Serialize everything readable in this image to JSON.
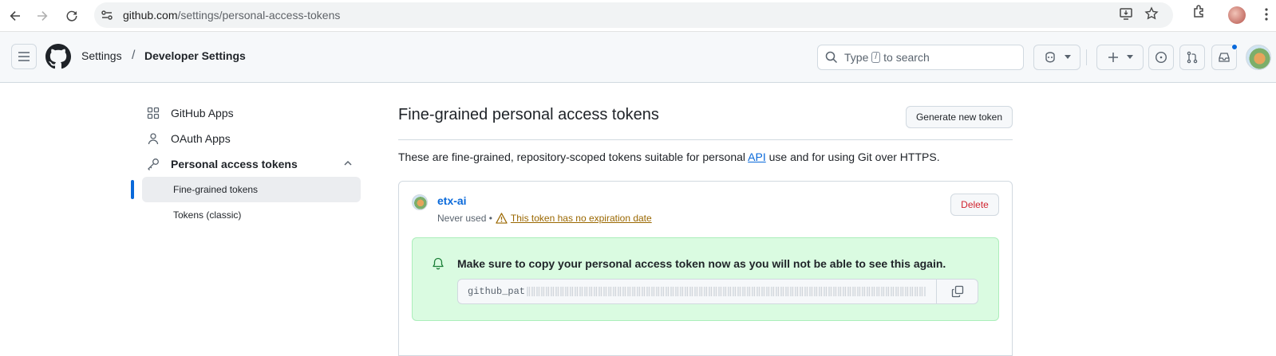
{
  "browser": {
    "url_domain": "github.com",
    "url_path": "/settings/personal-access-tokens",
    "icons": [
      "back-icon",
      "forward-icon",
      "reload-icon",
      "site-info-icon",
      "install-app-icon",
      "bookmark-star-icon",
      "extensions-icon",
      "profile-avatar",
      "more-vert-icon"
    ]
  },
  "header": {
    "breadcrumb_parent": "Settings",
    "breadcrumb_separator": "/",
    "breadcrumb_current": "Developer Settings",
    "search_prefix": "Type",
    "search_key": "/",
    "search_suffix": "to search",
    "icons": [
      "hamburger-icon",
      "github-logo-icon",
      "search-icon",
      "copilot-icon",
      "triangle-down-icon",
      "plus-icon",
      "issues-icon",
      "pull-requests-icon",
      "inbox-icon",
      "user-avatar"
    ]
  },
  "sidebar": {
    "items": [
      {
        "label": "GitHub Apps",
        "icon": "apps-grid-icon"
      },
      {
        "label": "OAuth Apps",
        "icon": "person-icon"
      },
      {
        "label": "Personal access tokens",
        "icon": "key-icon"
      }
    ],
    "sub_items": [
      {
        "label": "Fine-grained tokens",
        "active": true
      },
      {
        "label": "Tokens (classic)",
        "active": false
      }
    ]
  },
  "main": {
    "title": "Fine-grained personal access tokens",
    "generate_button": "Generate new token",
    "description_before": "These are fine-grained, repository-scoped tokens suitable for personal ",
    "description_link": "API",
    "description_after": " use and for using Git over HTTPS.",
    "token": {
      "name": "etx-ai",
      "last_used": "Never used •",
      "expiration_warning": "This token has no expiration date",
      "delete_button": "Delete",
      "flash_message": "Make sure to copy your personal access token now as you will not be able to see this again.",
      "token_prefix": "github_pat"
    }
  },
  "colors": {
    "accent": "#0969da",
    "danger": "#d1242f",
    "warning": "#9a6700",
    "success_bg": "#dafbe1",
    "success_border": "#aceebb"
  }
}
